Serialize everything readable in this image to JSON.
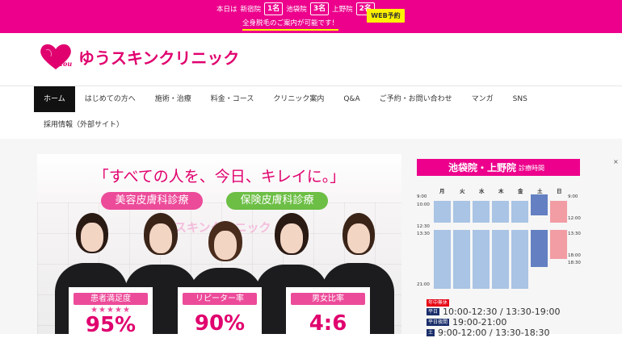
{
  "topbar": {
    "label_today": "本日は",
    "clinics": [
      {
        "name": "新宿院",
        "count": "1名"
      },
      {
        "name": "池袋院",
        "count": "3名"
      },
      {
        "name": "上野院",
        "count": "2名"
      }
    ],
    "web_button": "WEB予約",
    "sub_text": "全身脱毛のご案内が可能です！"
  },
  "logo": {
    "you": "You",
    "name": "ゆうスキンクリニック"
  },
  "nav": {
    "items": [
      "ホーム",
      "はじめての方へ",
      "施術・治療",
      "料金・コース",
      "クリニック案内",
      "Q&A",
      "ご予約・お問い合わせ",
      "マンガ",
      "SNS"
    ],
    "second_row": [
      "採用情報（外部サイト）"
    ]
  },
  "hero": {
    "title": "「すべての人を、今日、キレイに。」",
    "pill_left": "美容皮膚科診療",
    "pill_right": "保険皮膚科診療",
    "watermark": "ゆうスキンクリニック",
    "cards": [
      {
        "label": "患者満足度",
        "value": "95%",
        "stars": "★★★★★"
      },
      {
        "label": "リピーター率",
        "value": "90%"
      },
      {
        "label": "男女比率",
        "value": "4:6"
      }
    ]
  },
  "schedule": {
    "title": "池袋院・上野院",
    "subtitle": "診療時間",
    "days": [
      "月",
      "火",
      "水",
      "木",
      "金",
      "土",
      "日"
    ],
    "left_times": [
      "9:00",
      "10:00",
      "12:30",
      "13:30",
      "21:00"
    ],
    "right_times": [
      "9:00",
      "12:00",
      "13:30",
      "18:00",
      "18:30"
    ],
    "close_icon": "×",
    "hours": [
      {
        "tag": "年中無休",
        "tag_color": "#e60012",
        "text": ""
      },
      {
        "tag": "平日",
        "tag_color": "#1a2e6b",
        "text": "10:00-12:30 / 13:30-19:00"
      },
      {
        "tag": "平日夜間",
        "tag_color": "#1a2e6b",
        "text": "19:00-21:00"
      },
      {
        "tag": "土",
        "tag_color": "#1a2e6b",
        "text": "9:00-12:00 / 13:30-18:30"
      }
    ]
  },
  "colors": {
    "brand": "#ec008c",
    "accent": "#fff200",
    "light_blue": "#a9c4e4",
    "dark_blue": "#6480c2",
    "pink": "#f29ca4"
  }
}
